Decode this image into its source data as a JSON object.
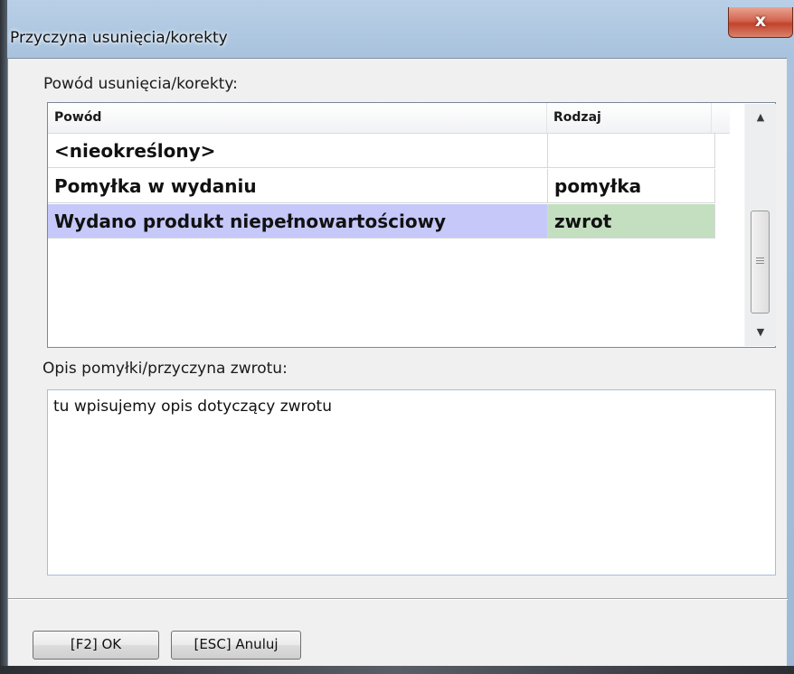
{
  "window": {
    "title": "Przyczyna usunięcia/korekty",
    "close_glyph": "x"
  },
  "reason_section": {
    "label": "Powód usunięcia/korekty:",
    "columns": [
      "Powód",
      "Rodzaj"
    ],
    "rows": [
      {
        "reason": "<nieokreślony>",
        "type": ""
      },
      {
        "reason": "Pomyłka w wydaniu",
        "type": "pomyłka"
      },
      {
        "reason": "Wydano produkt niepełnowartościowy",
        "type": "zwrot",
        "selected": true
      }
    ],
    "scrollbar": {
      "up_icon": "▲",
      "down_icon": "▼"
    }
  },
  "description_section": {
    "label": "Opis pomyłki/przyczyna zwrotu:",
    "value": "tu wpisujemy opis dotyczący zwrotu"
  },
  "buttons": {
    "ok_label": "[F2] OK",
    "cancel_label": "[ESC] Anuluj"
  },
  "colors": {
    "selected_reason_bg": "#c5c8f9",
    "selected_type_bg": "#c3dfc0",
    "close_button": "#c7472f",
    "titlebar": "#b3cae3"
  }
}
